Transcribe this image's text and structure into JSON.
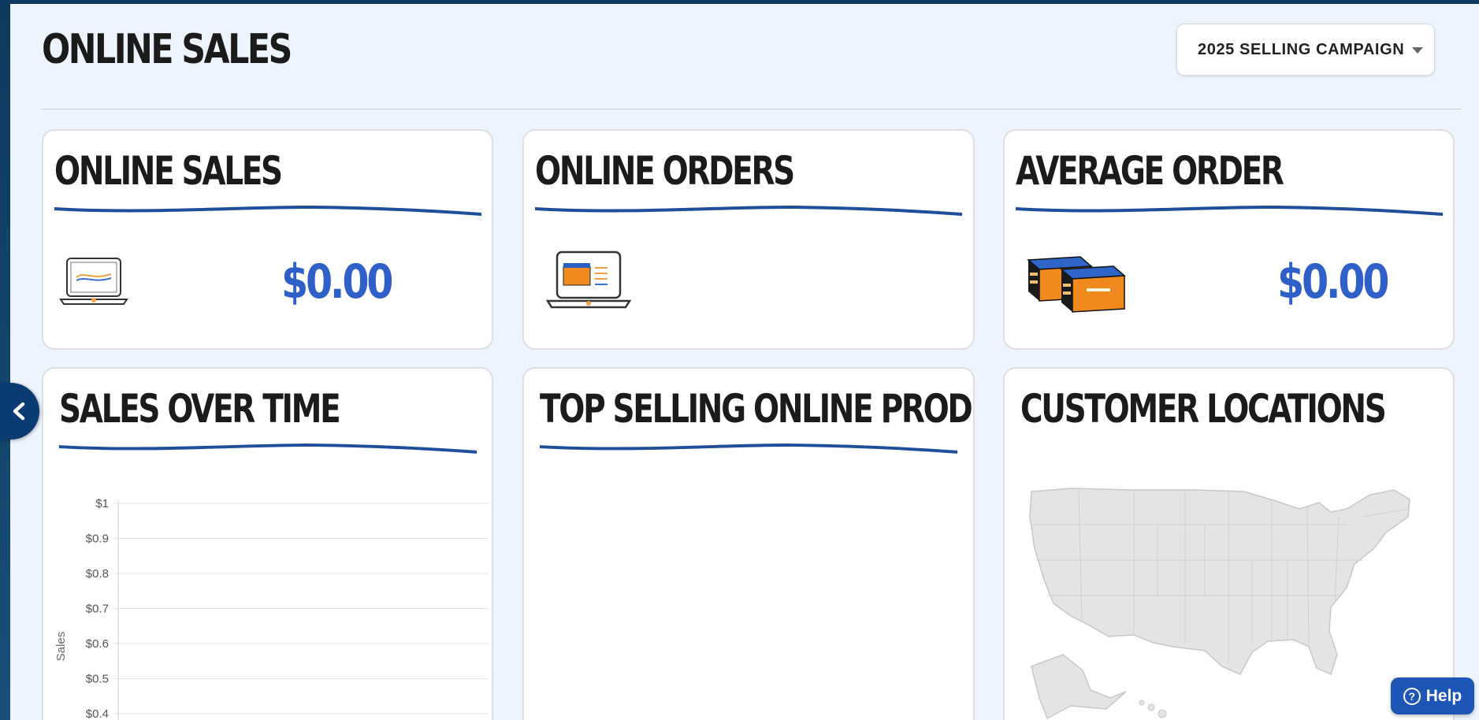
{
  "page": {
    "title": "ONLINE SALES",
    "campaign_select": "2025 SELLING CAMPAIGN"
  },
  "cards": {
    "online_sales": {
      "title": "ONLINE SALES",
      "value": "$0.00"
    },
    "online_orders": {
      "title": "ONLINE ORDERS"
    },
    "average_order": {
      "title": "AVERAGE ORDER",
      "value": "$0.00"
    },
    "sales_over_time": {
      "title": "SALES OVER TIME"
    },
    "top_products": {
      "title": "TOP SELLING ONLINE PRODUCTS"
    },
    "customer_locations": {
      "title": "CUSTOMER LOCATIONS"
    }
  },
  "chart_data": {
    "type": "line",
    "ylabel": "Sales",
    "y_ticks": [
      "$1",
      "$0.9",
      "$0.8",
      "$0.7",
      "$0.6",
      "$0.5",
      "$0.4"
    ],
    "y_tick_values": [
      1,
      0.9,
      0.8,
      0.7,
      0.6,
      0.5,
      0.4
    ],
    "grid": true,
    "series": []
  },
  "help": {
    "label": "Help"
  },
  "colors": {
    "accent": "#2f5fc9",
    "swoosh": "#1f4e9c",
    "help_button": "#1e56b8",
    "sidebar_tab": "#0b3b75",
    "panel_bg": "#eef4fd"
  }
}
